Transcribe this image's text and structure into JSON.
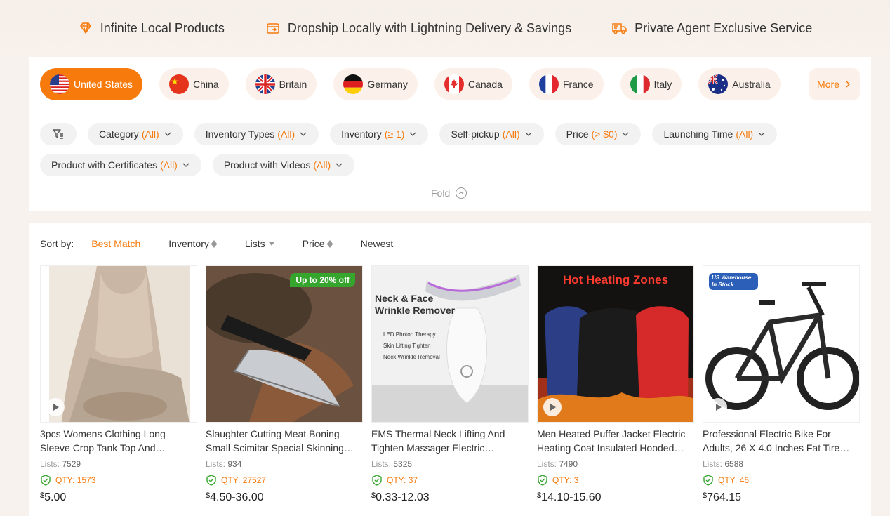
{
  "banner": {
    "items": [
      {
        "label": "Infinite Local Products",
        "icon": "diamond-icon"
      },
      {
        "label": "Dropship Locally with Lightning Delivery & Savings",
        "icon": "box-icon"
      },
      {
        "label": "Private Agent Exclusive Service",
        "icon": "truck-icon"
      }
    ]
  },
  "countries": [
    {
      "label": "United States",
      "active": true
    },
    {
      "label": "China"
    },
    {
      "label": "Britain"
    },
    {
      "label": "Germany"
    },
    {
      "label": "Canada"
    },
    {
      "label": "France"
    },
    {
      "label": "Italy"
    },
    {
      "label": "Australia"
    }
  ],
  "more_label": "More",
  "filters": {
    "row1": [
      {
        "label": "Category",
        "value": "(All)"
      },
      {
        "label": "Inventory Types",
        "value": "(All)"
      },
      {
        "label": "Inventory",
        "value": "(≥ 1)"
      },
      {
        "label": "Self-pickup",
        "value": "(All)"
      },
      {
        "label": "Price",
        "value": "(> $0)"
      },
      {
        "label": "Launching Time",
        "value": "(All)"
      }
    ],
    "row2": [
      {
        "label": "Product with Certificates",
        "value": "(All)"
      },
      {
        "label": "Product with Videos",
        "value": "(All)"
      }
    ],
    "fold_label": "Fold"
  },
  "sort": {
    "label": "Sort by:",
    "options": [
      "Best Match",
      "Inventory",
      "Lists",
      "Price",
      "Newest"
    ]
  },
  "products": [
    {
      "title": "3pcs Womens Clothing Long Sleeve Crop Tank Top And Cardigan Set",
      "lists_label": "Lists:",
      "lists": "7529",
      "qty_label": "QTY:",
      "qty": "1573",
      "currency": "$",
      "price": "5.00"
    },
    {
      "title": "Slaughter Cutting Meat Boning Small Scimitar Special Skinning Knife",
      "lists_label": "Lists:",
      "lists": "934",
      "qty_label": "QTY:",
      "qty": "27527",
      "currency": "$",
      "price": "4.50-36.00",
      "badge": "Up to 20% off"
    },
    {
      "title": "EMS Thermal Neck Lifting And Tighten Massager Electric Microcurrent",
      "lists_label": "Lists:",
      "lists": "5325",
      "qty_label": "QTY:",
      "qty": "37",
      "currency": "$",
      "price": "0.33-12.03",
      "image_text": {
        "line1": "Neck & Face",
        "line2": "Wrinkle Remover",
        "bullets": [
          "LED Photon Therapy",
          "Skin Lifting Tighten",
          "Neck Wrinkle Removal"
        ]
      }
    },
    {
      "title": "Men Heated Puffer Jacket Electric Heating Coat Insulated Hooded Winter",
      "lists_label": "Lists:",
      "lists": "7490",
      "qty_label": "QTY:",
      "qty": "3",
      "currency": "$",
      "price": "14.10-15.60",
      "image_text": "Hot Heating Zones"
    },
    {
      "title": "Professional Electric Bike For Adults, 26 X 4.0 Inches Fat Tire Ebike",
      "lists_label": "Lists:",
      "lists": "6588",
      "qty_label": "QTY:",
      "qty": "46",
      "currency": "$",
      "price": "764.15",
      "image_text": "US Warehouse In Stock"
    }
  ],
  "colors": {
    "accent": "#f77a0d",
    "chip_bg": "#f2f2f2",
    "country_bg": "#fbf1ea",
    "shield_green": "#35a52d"
  }
}
